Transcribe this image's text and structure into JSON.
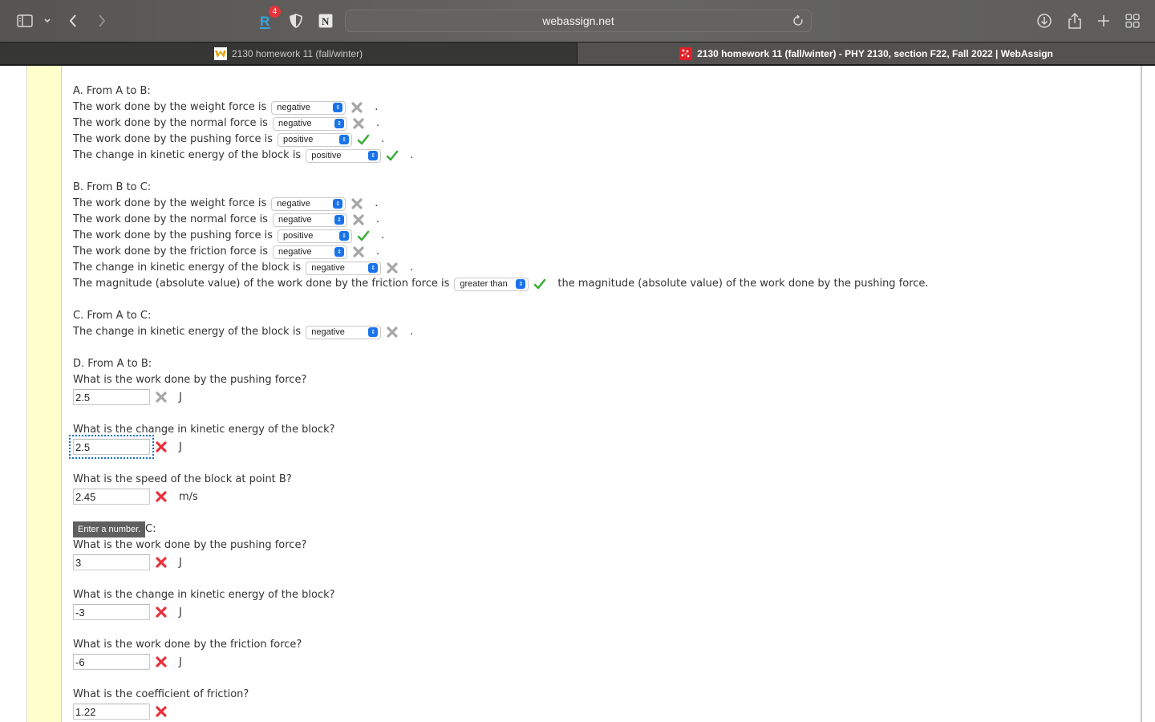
{
  "browser": {
    "url": "webassign.net",
    "extension_badge_count": "4",
    "tabs": [
      {
        "label": "2130 homework 11 (fall/winter)",
        "active": false
      },
      {
        "label": "2130 homework 11 (fall/winter) - PHY 2130, section F22, Fall 2022 | WebAssign",
        "active": true
      }
    ]
  },
  "colors": {
    "correct": "#3cae3c",
    "incorrect_active": "#e8323c",
    "incorrect_inactive": "#a6a6a6",
    "select_accent": "#1a73e8",
    "margin_yellow": "#ffffcc"
  },
  "sectionA": {
    "heading": "A. From A to B:",
    "rows": [
      {
        "prompt": "The work done by the weight force is",
        "value": "negative",
        "status": "incorrect",
        "suffix": "."
      },
      {
        "prompt": "The work done by the normal force is",
        "value": "negative",
        "status": "incorrect",
        "suffix": "."
      },
      {
        "prompt": "The work done by the pushing force is",
        "value": "positive",
        "status": "correct",
        "suffix": "."
      },
      {
        "prompt": "The change in kinetic energy of the block is",
        "value": "positive",
        "status": "correct",
        "suffix": "."
      }
    ]
  },
  "sectionB": {
    "heading": "B. From B to C:",
    "rows": [
      {
        "prompt": "The work done by the weight force is",
        "value": "negative",
        "status": "incorrect",
        "suffix": "."
      },
      {
        "prompt": "The work done by the normal force is",
        "value": "negative",
        "status": "incorrect",
        "suffix": "."
      },
      {
        "prompt": "The work done by the pushing force is",
        "value": "positive",
        "status": "correct",
        "suffix": "."
      },
      {
        "prompt": "The work done by the friction force is",
        "value": "negative",
        "status": "incorrect",
        "suffix": "."
      },
      {
        "prompt": "The change in kinetic energy of the block is",
        "value": "negative",
        "status": "incorrect",
        "suffix": "."
      }
    ],
    "comparison": {
      "prompt": "The magnitude (absolute value) of the work done by the friction force is",
      "value": "greater than",
      "status": "correct",
      "suffix": "the magnitude (absolute value) of the work done by the pushing force."
    }
  },
  "sectionC": {
    "heading": "C. From A to C:",
    "rows": [
      {
        "prompt": "The change in kinetic energy of the block is",
        "value": "negative",
        "status": "incorrect",
        "suffix": "."
      }
    ]
  },
  "sectionD": {
    "heading": "D. From A to B:",
    "questions": [
      {
        "prompt": "What is the work done by the pushing force?",
        "value": "2.5",
        "status": "incorrect-inactive",
        "unit": "J"
      },
      {
        "prompt": "What is the change in kinetic energy of the block?",
        "value": "2.5",
        "status": "incorrect",
        "unit": "J",
        "focused": true
      },
      {
        "prompt": "What is the speed of the block at point B?",
        "value": "2.45",
        "status": "incorrect",
        "unit": "m/s"
      }
    ]
  },
  "sectionE": {
    "heading_visible_tail": "C:",
    "tooltip": "Enter a number.",
    "questions": [
      {
        "prompt": "What is the work done by the pushing force?",
        "value": "3",
        "status": "incorrect",
        "unit": "J"
      },
      {
        "prompt": "What is the change in kinetic energy of the block?",
        "value": "-3",
        "status": "incorrect",
        "unit": "J"
      },
      {
        "prompt": "What is the work done by the friction force?",
        "value": "-6",
        "status": "incorrect",
        "unit": "J"
      },
      {
        "prompt": "What is the coefficient of friction?",
        "value": "1.22",
        "status": "incorrect",
        "unit": ""
      }
    ]
  }
}
